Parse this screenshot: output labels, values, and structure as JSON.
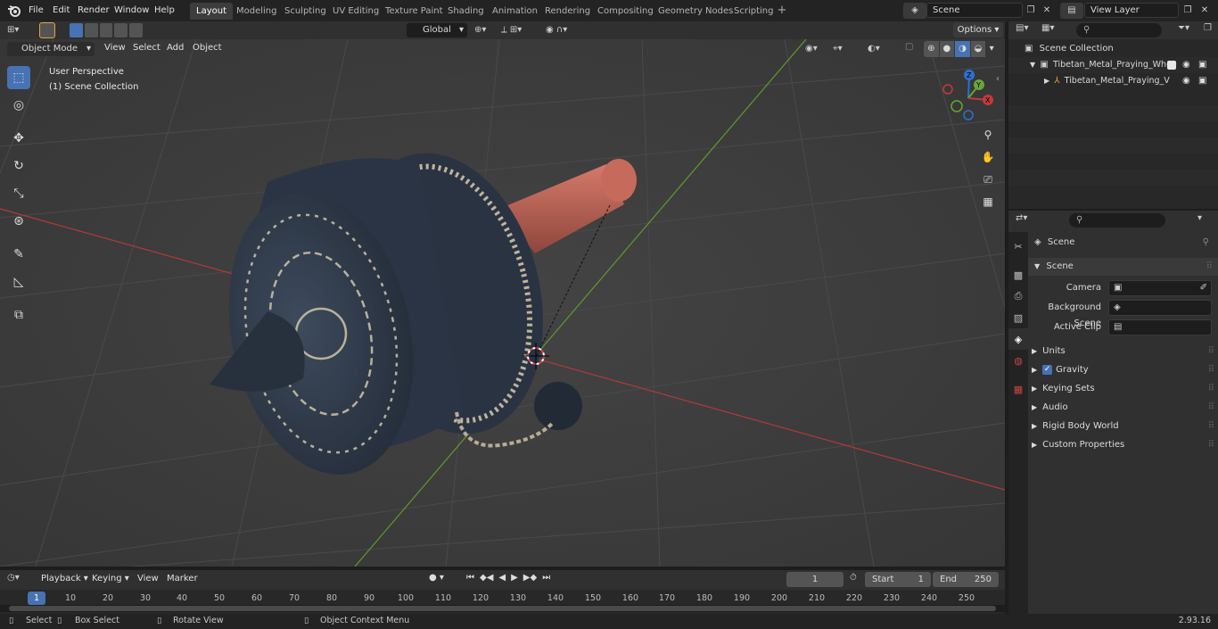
{
  "topbar": {
    "menus": [
      "File",
      "Edit",
      "Render",
      "Window",
      "Help"
    ],
    "workspaces": [
      "Layout",
      "Modeling",
      "Sculpting",
      "UV Editing",
      "Texture Paint",
      "Shading",
      "Animation",
      "Rendering",
      "Compositing",
      "Geometry Nodes",
      "Scripting"
    ],
    "active_workspace": "Layout",
    "add_tab": "+",
    "scene_name": "Scene",
    "view_layer_name": "View Layer"
  },
  "viewport_header": {
    "mode": "Object Mode",
    "menus": [
      "View",
      "Select",
      "Add",
      "Object"
    ],
    "transform_orientation": "Global",
    "options_label": "Options"
  },
  "viewport": {
    "perspective_label": "User Perspective",
    "collection_label": "(1) Scene Collection",
    "gizmo_axes": [
      "X",
      "Y",
      "Z"
    ],
    "colors": {
      "x_axis": "#c23a3a",
      "y_axis": "#6aa531",
      "z_axis": "#2f6fd0",
      "background": "#3d3d3d",
      "grid": "#4a4a4a"
    }
  },
  "tools": [
    "select-box",
    "cursor",
    "move",
    "rotate",
    "scale",
    "transform",
    "annotate",
    "measure",
    "add-cube"
  ],
  "outliner": {
    "root": "Scene Collection",
    "items": [
      {
        "label": "Tibetan_Metal_Praying_Whee",
        "level": 1
      },
      {
        "label": "Tibetan_Metal_Praying_V",
        "level": 2
      }
    ]
  },
  "properties": {
    "context": "Scene",
    "panel_title": "Scene",
    "fields": [
      {
        "label": "Camera",
        "value": ""
      },
      {
        "label": "Background Scene",
        "value": ""
      },
      {
        "label": "Active Clip",
        "value": ""
      }
    ],
    "subpanels": [
      "Units",
      "Gravity",
      "Keying Sets",
      "Audio",
      "Rigid Body World",
      "Custom Properties"
    ],
    "gravity_checked": true
  },
  "timeline": {
    "menus": [
      "Playback",
      "Keying",
      "View",
      "Marker"
    ],
    "current_frame": "1",
    "start_label": "Start",
    "start_value": "1",
    "end_label": "End",
    "end_value": "250",
    "ticks": [
      "1",
      "10",
      "20",
      "30",
      "40",
      "50",
      "60",
      "70",
      "80",
      "90",
      "100",
      "110",
      "120",
      "130",
      "140",
      "150",
      "160",
      "170",
      "180",
      "190",
      "200",
      "210",
      "220",
      "230",
      "240",
      "250"
    ]
  },
  "statusbar": {
    "hints": [
      "Select",
      "Box Select",
      "Rotate View",
      "Object Context Menu"
    ],
    "version": "2.93.16"
  }
}
